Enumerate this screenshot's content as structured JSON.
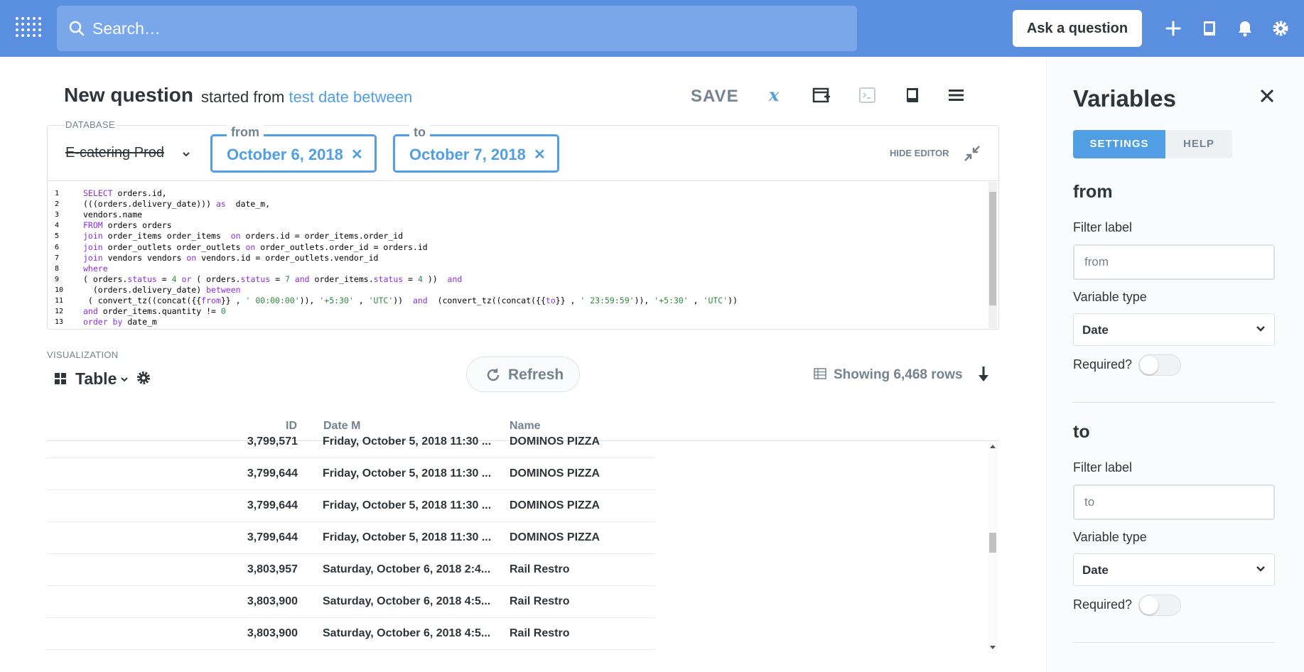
{
  "topbar": {
    "search_placeholder": "Search…",
    "ask_label": "Ask a question",
    "icons": [
      "plus-icon",
      "book-icon",
      "bell-icon",
      "gear-icon"
    ],
    "brand_color": "#5a8fe0"
  },
  "header": {
    "title": "New question",
    "started_from": "started from",
    "source_link": "test date between",
    "save_label": "SAVE"
  },
  "editor": {
    "database_label": "DATABASE",
    "database_name": "E-catering Prod",
    "filters": [
      {
        "label": "from",
        "value": "October 6, 2018"
      },
      {
        "label": "to",
        "value": "October 7, 2018"
      }
    ],
    "hide_editor_label": "HIDE EDITOR",
    "code_lines": [
      {
        "n": "1",
        "html": "<span class=\"kw\">SELECT</span> orders.id,"
      },
      {
        "n": "2",
        "html": "(((orders.delivery_date))) <span class=\"kw\">as</span>  date_m,"
      },
      {
        "n": "3",
        "html": "vendors.name"
      },
      {
        "n": "4",
        "html": "<span class=\"kw\">FROM</span> orders orders"
      },
      {
        "n": "5",
        "html": "<span class=\"kw\">join</span> order_items order_items  <span class=\"kw\">on</span> orders.id = order_items.order_id"
      },
      {
        "n": "6",
        "html": "<span class=\"kw\">join</span> order_outlets order_outlets <span class=\"kw\">on</span> order_outlets.order_id = orders.id"
      },
      {
        "n": "7",
        "html": "<span class=\"kw\">join</span> vendors vendors <span class=\"kw\">on</span> vendors.id = order_outlets.vendor_id"
      },
      {
        "n": "8",
        "html": "<span class=\"kw\">where</span>"
      },
      {
        "n": "9",
        "html": "( orders.<span class=\"kw\">status</span> = <span class=\"num\">4</span> <span class=\"kw\">or</span> ( orders.<span class=\"kw\">status</span> = <span class=\"num\">7</span> <span class=\"kw\">and</span> order_items.<span class=\"kw\">status</span> = <span class=\"num\">4</span> ))  <span class=\"kw\">and</span>"
      },
      {
        "n": "10",
        "html": "  (orders.delivery_date) <span class=\"kw\">between</span>"
      },
      {
        "n": "11",
        "html": " ( convert_tz((concat({{<span class=\"kw\">from</span>}} , <span class=\"str\">' 00:00:00'</span>)), <span class=\"str\">'+5:30'</span> , <span class=\"str\">'UTC'</span>))  <span class=\"kw\">and</span>  (convert_tz((concat({{<span class=\"kw\">to</span>}} , <span class=\"str\">' 23:59:59'</span>)), <span class=\"str\">'+5:30'</span> , <span class=\"str\">'UTC'</span>))"
      },
      {
        "n": "12",
        "html": "<span class=\"kw\">and</span> order_items.quantity != <span class=\"num\">0</span>"
      },
      {
        "n": "13",
        "html": "<span class=\"kw\">order by</span> date_m"
      }
    ]
  },
  "visualization": {
    "label": "VISUALIZATION",
    "type": "Table",
    "refresh_label": "Refresh",
    "row_count": "Showing 6,468 rows"
  },
  "table": {
    "columns": [
      "ID",
      "Date M",
      "Name"
    ],
    "rows": [
      [
        "3,799,571",
        "Friday, October 5, 2018 11:30 ...",
        "DOMINOS PIZZA"
      ],
      [
        "3,799,644",
        "Friday, October 5, 2018 11:30 ...",
        "DOMINOS PIZZA"
      ],
      [
        "3,799,644",
        "Friday, October 5, 2018 11:30 ...",
        "DOMINOS PIZZA"
      ],
      [
        "3,799,644",
        "Friday, October 5, 2018 11:30 ...",
        "DOMINOS PIZZA"
      ],
      [
        "3,803,957",
        "Saturday, October 6, 2018 2:4...",
        "Rail Restro"
      ],
      [
        "3,803,900",
        "Saturday, October 6, 2018 4:5...",
        "Rail Restro"
      ],
      [
        "3,803,900",
        "Saturday, October 6, 2018 4:5...",
        "Rail Restro"
      ]
    ]
  },
  "sidebar": {
    "title": "Variables",
    "tabs": [
      "SETTINGS",
      "HELP"
    ],
    "active_tab": "SETTINGS",
    "variables": [
      {
        "name": "from",
        "filter_label_title": "Filter label",
        "filter_label": "from",
        "type_title": "Variable type",
        "type": "Date",
        "required_title": "Required?",
        "required": false
      },
      {
        "name": "to",
        "filter_label_title": "Filter label",
        "filter_label": "to",
        "type_title": "Variable type",
        "type": "Date",
        "required_title": "Required?",
        "required": false
      }
    ]
  }
}
